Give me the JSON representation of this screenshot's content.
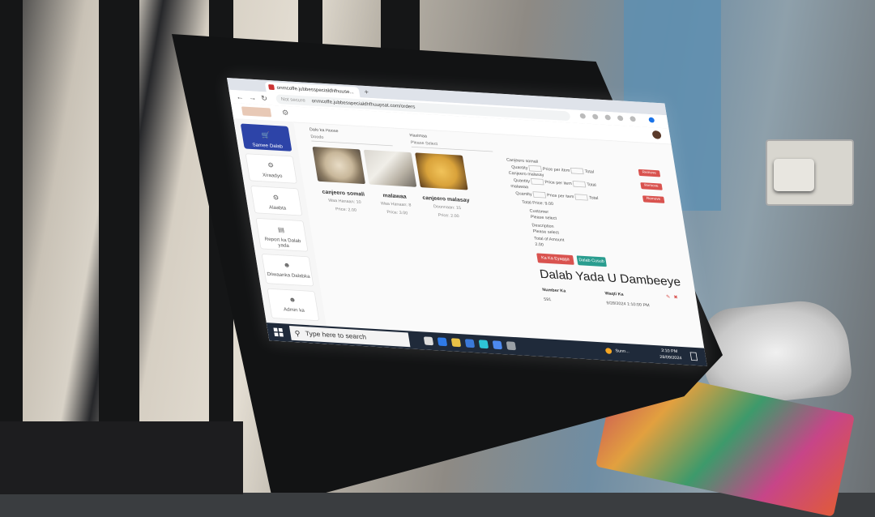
{
  "browser": {
    "tab_title": "onmcoffe.jubbesspecialdhfhuuse...",
    "new_tab_symbol": "+",
    "url": "onmcoffe.jubbesspecialdhfhuupsat.com/orders",
    "security_label": "Not secure"
  },
  "sidebar": {
    "items": [
      {
        "label": "Samee Dalab",
        "icon": "cart-icon"
      },
      {
        "label": "Xiraadyo",
        "icon": "gear-icon"
      },
      {
        "label": "Alaabta",
        "icon": "gear-icon"
      },
      {
        "label": "Report ka Dalab yada",
        "icon": "report-icon"
      },
      {
        "label": "Diiwaanka Dalabka",
        "icon": "user-icon"
      },
      {
        "label": "Admin ka",
        "icon": "user-icon"
      }
    ]
  },
  "filters": {
    "left_label": "Dalo ka Hoose",
    "left_value": "Doodo",
    "right_label": "Haximaa",
    "right_value": "Please Select"
  },
  "products": [
    {
      "name": "canjeero somali",
      "line1": "Waa Hanaan: 10",
      "line2": "Price: 2.00"
    },
    {
      "name": "malawaa",
      "line1": "Waa Hanaan: 8",
      "line2": "Price: 3.00"
    },
    {
      "name": "canjeero malasay",
      "line1": "Doonnaan: 15",
      "line2": "Price: 2.00"
    }
  ],
  "order": {
    "lines": [
      {
        "name": "Canjeero somali",
        "detail": "Quantity",
        "price_label": "Price per item",
        "unit": "Total",
        "delete": "Remove"
      },
      {
        "name": "Canjeero malasay",
        "detail": "Quantity",
        "price_label": "Price per item",
        "unit": "Total",
        "delete": "Remove"
      },
      {
        "name": "malawaa",
        "detail": "Quantity",
        "price_label": "Price per item",
        "unit": "Total",
        "delete": "Remove"
      }
    ],
    "summary": [
      "Total Price: 9.00",
      "Customer",
      "Please select",
      "Description",
      "Please select",
      "Total of Amount",
      "2.00"
    ],
    "btn_cancel": "Ka Ka Eyagga Dalab",
    "btn_save": "Dalab Cusub"
  },
  "recent": {
    "heading": "Dalab Yada U Dambeeye",
    "col1": "Number Ka",
    "col2": "Waqti Ka",
    "row_col1": "591",
    "row_col2": "9/28/2024 1:10:00 PM"
  },
  "taskbar": {
    "search_placeholder": "Type here to search",
    "weather": "Sunn...",
    "time": "3:10 PM",
    "date": "28/09/2024"
  },
  "colors": {
    "sidebar_active": "#2d44a8",
    "delete_button": "#d9534f",
    "save_button": "#2a9d8f",
    "cancel_button": "#d9534f",
    "taskbar": "#1f2a3a"
  }
}
